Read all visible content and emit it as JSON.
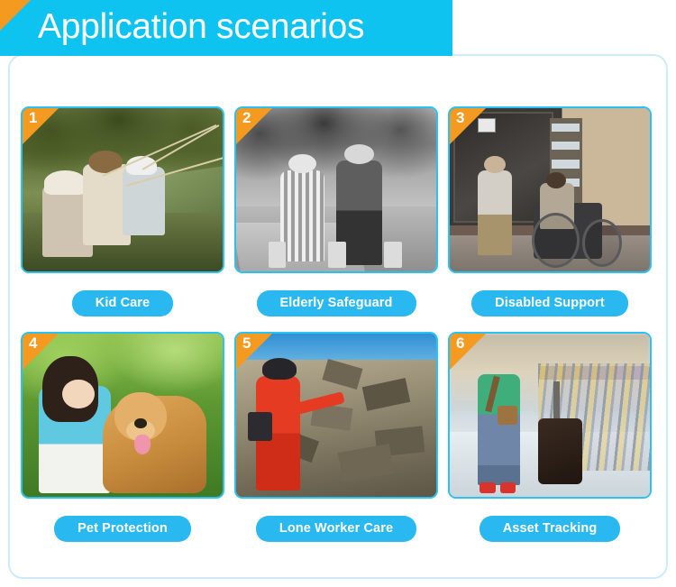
{
  "header": {
    "title": "Application scenarios",
    "banner_color": "#0fc3f0",
    "corner_color": "#f49a20",
    "title_color": "#ffffff"
  },
  "frame": {
    "border_color": "#cdecf8"
  },
  "theme": {
    "pill_color": "#29b8f0",
    "photo_border_color": "#29c2f2",
    "badge_color": "#f49a20"
  },
  "cards": [
    {
      "number": "1",
      "label": "Kid Care",
      "image_alt": "Children fishing with rods on a grassy river bank"
    },
    {
      "number": "2",
      "label": "Elderly Safeguard",
      "image_alt": "Black and white photo of two elderly people walking with bags on a park path"
    },
    {
      "number": "3",
      "label": "Disabled Support",
      "image_alt": "Man pushing a person in a wheelchair past a storefront window"
    },
    {
      "number": "4",
      "label": "Pet Protection",
      "image_alt": "Young girl in a blue top hugging a golden retriever on green grass"
    },
    {
      "number": "5",
      "label": "Lone Worker Care",
      "image_alt": "Worker in a red suit and black helmet inspecting a rocky slope"
    },
    {
      "number": "6",
      "label": "Asset Tracking",
      "image_alt": "Woman in green top walking with a dark suitcase past airport luggage carts"
    }
  ]
}
